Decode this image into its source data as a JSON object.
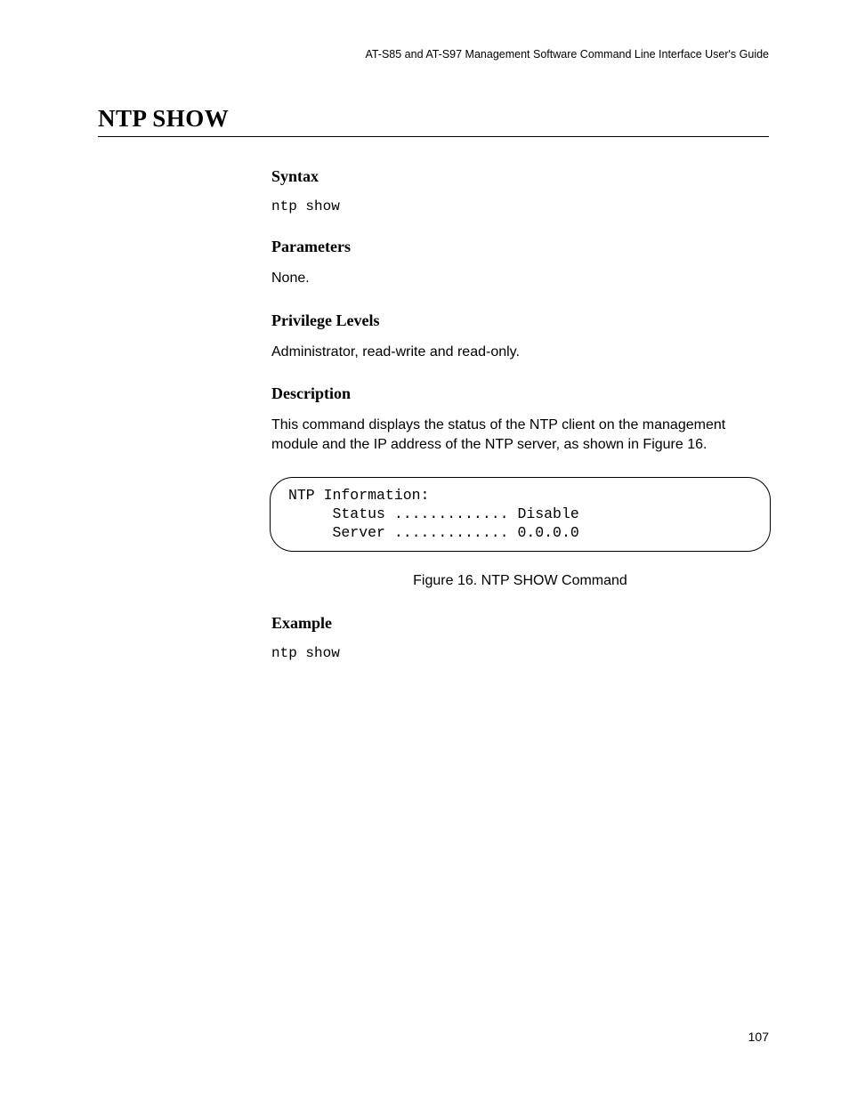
{
  "header": {
    "running": "AT-S85 and AT-S97 Management Software Command Line Interface User's Guide"
  },
  "title": "NTP SHOW",
  "sections": {
    "syntax": {
      "heading": "Syntax",
      "code": "ntp show"
    },
    "parameters": {
      "heading": "Parameters",
      "text": "None."
    },
    "privilege": {
      "heading": "Privilege Levels",
      "text": "Administrator, read-write and read-only."
    },
    "description": {
      "heading": "Description",
      "text": "This command displays the status of the NTP client on the management module and the IP address of the NTP server, as shown in Figure 16."
    },
    "figure": {
      "lines": "NTP Information:\n     Status ............. Disable\n     Server ............. 0.0.0.0",
      "caption": "Figure 16. NTP SHOW Command"
    },
    "example": {
      "heading": "Example",
      "code": "ntp show"
    }
  },
  "page_number": "107"
}
